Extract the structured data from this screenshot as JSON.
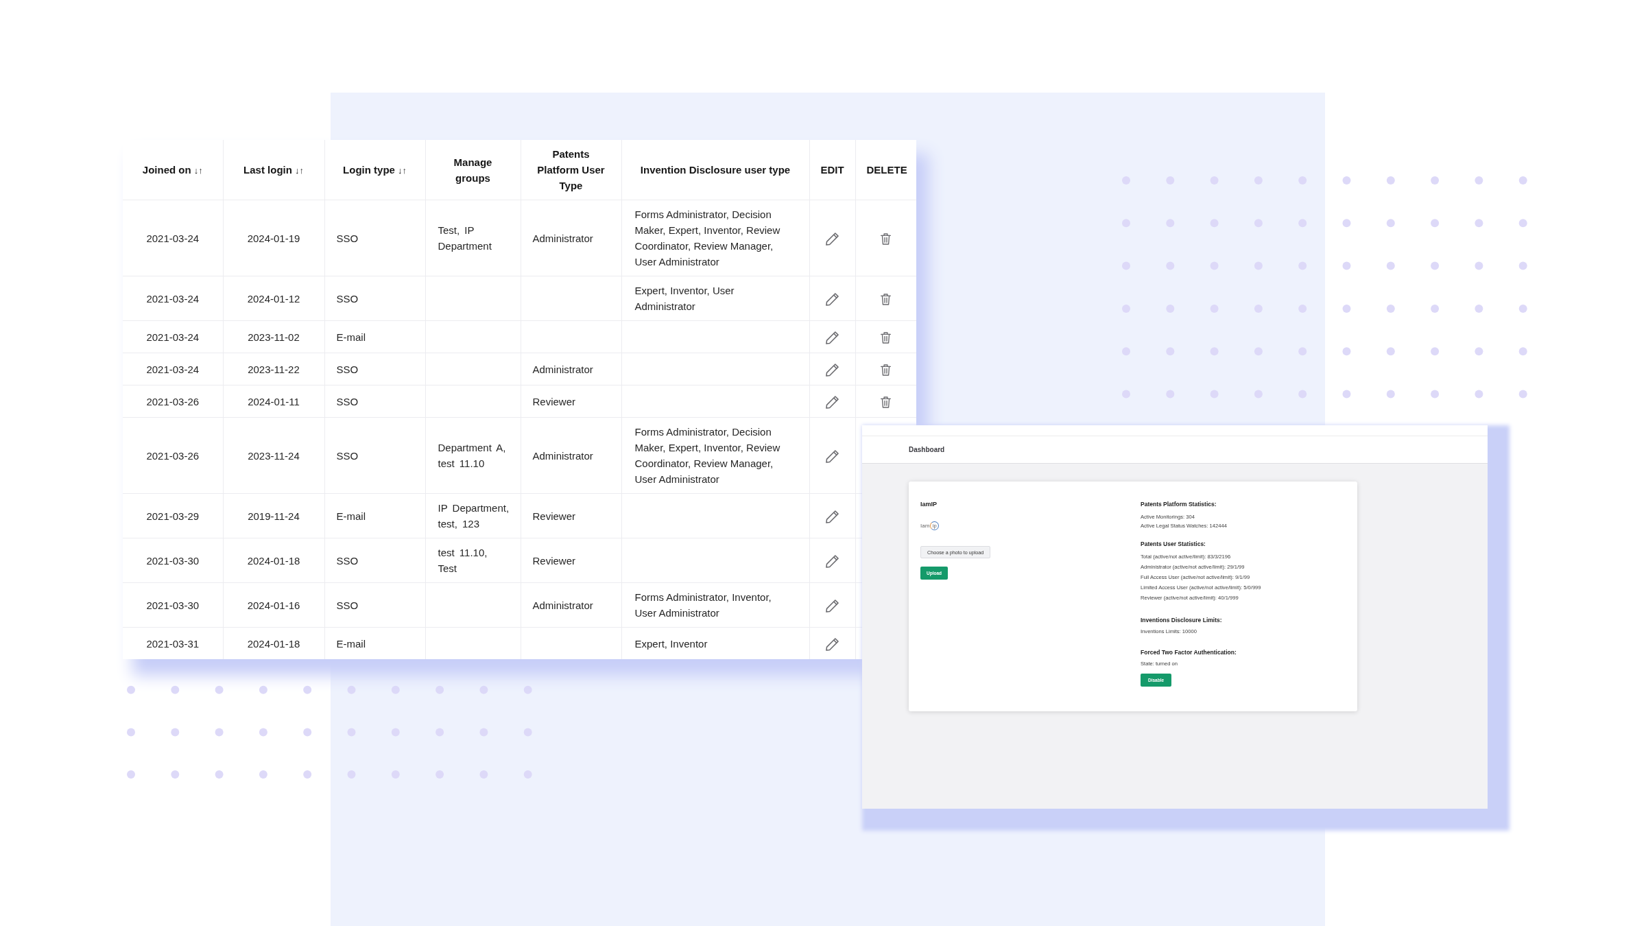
{
  "table": {
    "columns": [
      {
        "label": "Joined on",
        "sort": "↓↑"
      },
      {
        "label": "Last login",
        "sort": "↓↑"
      },
      {
        "label": "Login type",
        "sort": "↓↑"
      },
      {
        "label": "Manage groups"
      },
      {
        "label": "Patents Platform User Type"
      },
      {
        "label": "Invention Disclosure user type"
      },
      {
        "label": "EDIT"
      },
      {
        "label": "DELETE"
      }
    ],
    "rows": [
      {
        "joined_on": "2021-03-24",
        "last_login": "2024-01-19",
        "login_type": "SSO",
        "manage_groups": "Test, IP Department",
        "patents_platform_user_type": "Administrator",
        "invention_disclosure_user_type": "Forms Administrator, Decision Maker, Expert, Inventor, Review Coordinator, Review Manager, User Administrator",
        "delete_icon": true
      },
      {
        "joined_on": "2021-03-24",
        "last_login": "2024-01-12",
        "login_type": "SSO",
        "invention_disclosure_user_type": "Expert, Inventor, User Administrator",
        "delete_icon": true
      },
      {
        "joined_on": "2021-03-24",
        "last_login": "2023-11-02",
        "login_type": "E-mail",
        "delete_icon": true
      },
      {
        "joined_on": "2021-03-24",
        "last_login": "2023-11-22",
        "login_type": "SSO",
        "patents_platform_user_type": "Administrator",
        "delete_icon": true
      },
      {
        "joined_on": "2021-03-26",
        "last_login": "2024-01-11",
        "login_type": "SSO",
        "patents_platform_user_type": "Reviewer",
        "delete_icon": true
      },
      {
        "joined_on": "2021-03-26",
        "last_login": "2023-11-24",
        "login_type": "SSO",
        "manage_groups": "Department A, test 11.10",
        "patents_platform_user_type": "Administrator",
        "invention_disclosure_user_type": "Forms Administrator, Decision Maker, Expert, Inventor, Review Coordinator, Review Manager, User Administrator"
      },
      {
        "joined_on": "2021-03-29",
        "last_login": "2019-11-24",
        "login_type": "E-mail",
        "manage_groups": "IP Department, test, 123",
        "patents_platform_user_type": "Reviewer"
      },
      {
        "joined_on": "2021-03-30",
        "last_login": "2024-01-18",
        "login_type": "SSO",
        "manage_groups": "test 11.10, Test",
        "patents_platform_user_type": "Reviewer"
      },
      {
        "joined_on": "2021-03-30",
        "last_login": "2024-01-16",
        "login_type": "SSO",
        "patents_platform_user_type": "Administrator",
        "invention_disclosure_user_type": "Forms Administrator, Inventor, User Administrator"
      },
      {
        "joined_on": "2021-03-31",
        "last_login": "2024-01-18",
        "login_type": "E-mail",
        "invention_disclosure_user_type": "Expert, Inventor"
      }
    ]
  },
  "dashboard": {
    "breadcrumb": "Dashboard",
    "card": {
      "title": "IamIP",
      "logo": {
        "text": "Iam",
        "mark": "ip"
      },
      "buttons": [
        {
          "label": "Choose a photo to upload",
          "kind": "secondary"
        },
        {
          "label": "Upload",
          "kind": "primary"
        }
      ],
      "sections": [
        {
          "heading": "Patents Platform Statistics:",
          "lines": [
            "Active Monitorings: 304",
            "Active Legal Status Watches: 142444"
          ]
        },
        {
          "heading": "Patents User Statistics:",
          "lines": [
            "Total (active/not active/limit): 83/3/2196",
            "Administrator (active/not active/limit): 29/1/99",
            "Full Access User (active/not active/limit): 9/1/99",
            "Limited Access User (active/not active/limit): 5/0/999",
            "Reviewer (active/not active/limit): 40/1/999"
          ]
        },
        {
          "heading": "Inventions Disclosure Limits:",
          "lines": [
            "Inventions Limits: 10000"
          ]
        },
        {
          "heading": "Forced Two Factor Authentication:",
          "lines": [
            "State: turned on"
          ],
          "button": {
            "label": "Disable",
            "kind": "primary"
          }
        }
      ]
    }
  }
}
